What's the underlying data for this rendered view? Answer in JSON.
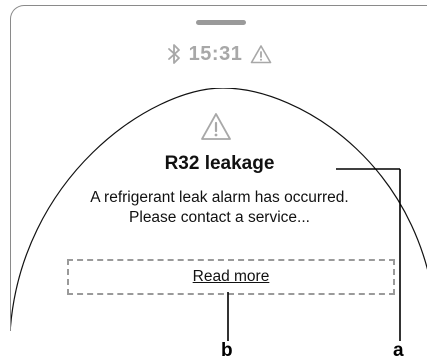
{
  "status_bar": {
    "time": "15:31",
    "icons": [
      "bluetooth-icon",
      "warning-icon"
    ]
  },
  "alert": {
    "icon": "warning-icon",
    "title": "R32 leakage",
    "message_line1": "A refrigerant leak alarm has occurred.",
    "message_line2": "Please contact a service...",
    "read_more_label": "Read more"
  },
  "callouts": {
    "a": "a",
    "b": "b"
  },
  "colors": {
    "icon_gray": "#a8a8a8",
    "frame_gray": "#8a8a8a",
    "text": "#111111"
  }
}
